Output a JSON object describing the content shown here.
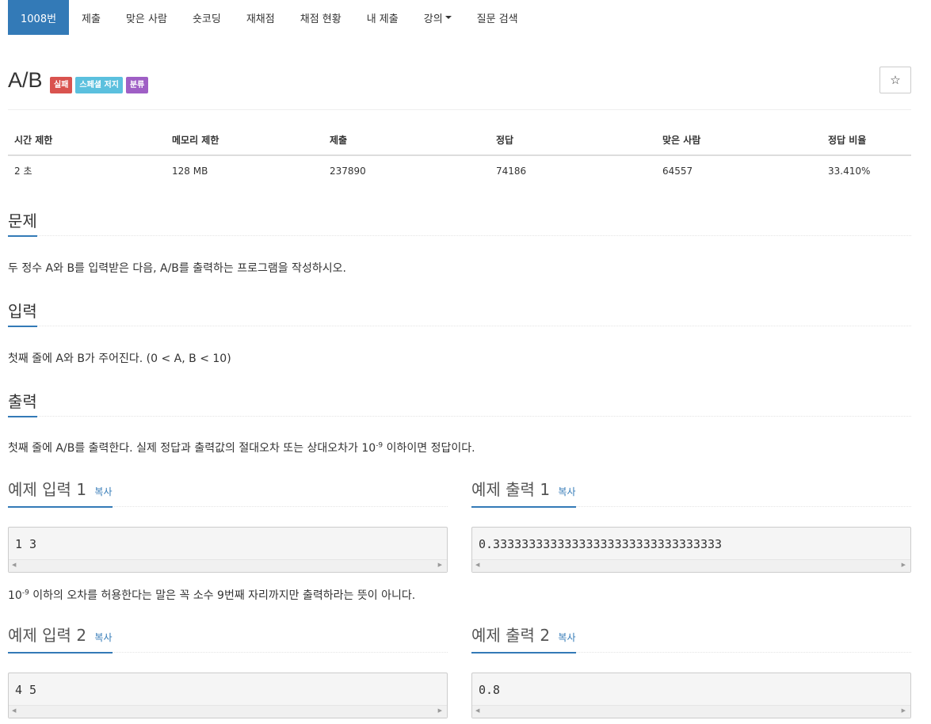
{
  "nav": {
    "items": [
      "1008번",
      "제출",
      "맞은 사람",
      "숏코딩",
      "재채점",
      "채점 현황",
      "내 제출",
      "강의",
      "질문 검색"
    ]
  },
  "problem": {
    "title": "A/B",
    "labels": [
      "실패",
      "스페셜 저지",
      "분류"
    ],
    "star": "☆"
  },
  "info": {
    "headers": [
      "시간 제한",
      "메모리 제한",
      "제출",
      "정답",
      "맞은 사람",
      "정답 비율"
    ],
    "values": [
      "2 초",
      "128 MB",
      "237890",
      "74186",
      "64557",
      "33.410%"
    ]
  },
  "sections": {
    "problem": {
      "title": "문제",
      "text": "두 정수 A와 B를 입력받은 다음, A/B를 출력하는 프로그램을 작성하시오."
    },
    "input": {
      "title": "입력",
      "text": "첫째 줄에 A와 B가 주어진다. (0 < A, B < 10)"
    },
    "output": {
      "title": "출력",
      "text_before": "첫째 줄에 A/B를 출력한다. 실제 정답과 출력값의 절대오차 또는 상대오차가 10",
      "exp": "-9",
      "text_after": " 이하이면 정답이다."
    }
  },
  "samples": {
    "copy_label": "복사",
    "in1": {
      "title": "예제 입력 1",
      "value": "1 3"
    },
    "out1": {
      "title": "예제 출력 1",
      "value": "0.33333333333333333333333333333333"
    },
    "note": {
      "base": "10",
      "exp": "-9",
      "text": " 이하의 오차를 허용한다는 말은 꼭 소수 9번째 자리까지만 출력하라는 뜻이 아니다."
    },
    "in2": {
      "title": "예제 입력 2",
      "value": "4 5"
    },
    "out2": {
      "title": "예제 출력 2",
      "value": "0.8"
    }
  }
}
